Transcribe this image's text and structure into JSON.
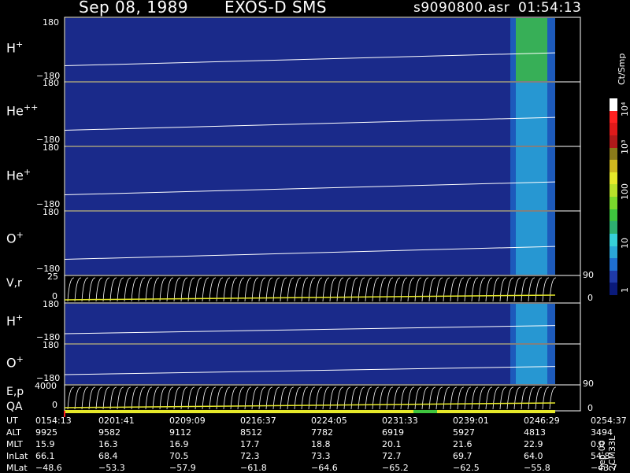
{
  "header": {
    "date": "Sep 08, 1989",
    "instrument": "EXOS-D SMS",
    "file": "s9090800.asr",
    "time": "01:54:13"
  },
  "colorbar": {
    "unit": "Ct/Smp",
    "tick_labels": [
      "10⁴",
      "10³",
      "100",
      "10",
      "1"
    ],
    "colors": [
      "#0a1a7a",
      "#1f3aa8",
      "#1f6fd0",
      "#2aa6d8",
      "#36d0d8",
      "#2db070",
      "#3ec43e",
      "#7ad82c",
      "#b8e02a",
      "#e6e82a",
      "#d0b81f",
      "#8a7a1a",
      "#b01a1a",
      "#e01a1a",
      "#ff2222",
      "#ffffff"
    ]
  },
  "chart_data": {
    "type": "heatmap",
    "title": "EXOS-D SMS Sep 08, 1989",
    "panels": [
      {
        "label": "H",
        "sup": "+",
        "ymax": "180",
        "ymin": "−180",
        "ylim": [
          -180,
          180
        ]
      },
      {
        "label": "He",
        "sup": "++",
        "ymax": "180",
        "ymin": "−180",
        "ylim": [
          -180,
          180
        ]
      },
      {
        "label": "He",
        "sup": "+",
        "ymax": "180",
        "ymin": "−180",
        "ylim": [
          -180,
          180
        ]
      },
      {
        "label": "O",
        "sup": "+",
        "ymax": "180",
        "ymin": "−180",
        "ylim": [
          -180,
          180
        ]
      },
      {
        "label": "V,r",
        "sup": "",
        "ymax": "25",
        "ymin": "0",
        "right_top": "90",
        "right_bottom": "0",
        "ylim": [
          0,
          25
        ]
      },
      {
        "label": "H",
        "sup": "+",
        "ymax": "180",
        "ymin": "−180",
        "ylim": [
          -180,
          180
        ]
      },
      {
        "label": "O",
        "sup": "+",
        "ymax": "180",
        "ymin": "−180",
        "ylim": [
          -180,
          180
        ]
      },
      {
        "label": "E,p",
        "sup": "",
        "label2": "QA",
        "ymax": "4000",
        "ymin": "0",
        "right_top": "90",
        "right_bottom": "0",
        "ylim": [
          0,
          4000
        ]
      }
    ],
    "x_ticks_ut": [
      "0154:13",
      "0201:41",
      "0209:09",
      "0216:37",
      "0224:05",
      "0231:33",
      "0239:01",
      "0246:29",
      "0254:37"
    ]
  },
  "table": {
    "rows": [
      {
        "label": "UT",
        "values": [
          "0154:13",
          "0201:41",
          "0209:09",
          "0216:37",
          "0224:05",
          "0231:33",
          "0239:01",
          "0246:29",
          "0254:37"
        ]
      },
      {
        "label": "ALT",
        "values": [
          "9925",
          "9582",
          "9112",
          "8512",
          "7782",
          "6919",
          "5927",
          "4813",
          "3494"
        ]
      },
      {
        "label": "MLT",
        "values": [
          "15.9",
          "16.3",
          "16.9",
          "17.7",
          "18.8",
          "20.1",
          "21.6",
          "22.9",
          "0.0"
        ]
      },
      {
        "label": "InLat",
        "values": [
          "66.1",
          "68.4",
          "70.5",
          "72.3",
          "73.3",
          "72.7",
          "69.7",
          "64.0",
          "54.8"
        ]
      },
      {
        "label": "MLat",
        "values": [
          "−48.6",
          "−53.3",
          "−57.9",
          "−61.8",
          "−64.6",
          "−65.2",
          "−62.5",
          "−55.8",
          "−43.7"
        ]
      }
    ]
  },
  "footer_vertical": "Sep-00  2CM33L"
}
